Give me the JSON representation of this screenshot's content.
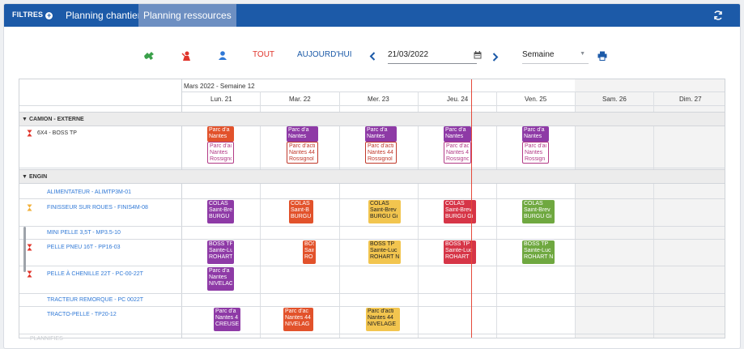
{
  "topbar": {
    "filters_label": "FILTRES",
    "tabs": [
      {
        "label": "Planning chantiers",
        "active": false
      },
      {
        "label": "Planning ressources",
        "active": true
      }
    ]
  },
  "toolbar": {
    "all_label": "TOUT",
    "today_label": "AUJOURD'HUI",
    "date_value": "21/03/2022",
    "period_value": "Semaine"
  },
  "grid": {
    "header_week": "Mars 2022 - Semaine 12",
    "days": [
      "Lun. 21",
      "Mar. 22",
      "Mer. 23",
      "Jeu. 24",
      "Ven. 25",
      "Sam. 26",
      "Dim. 27"
    ],
    "groups": [
      {
        "label": "CAMION - EXTERNE"
      },
      {
        "label": "ENGIN"
      }
    ],
    "resources": [
      {
        "label": "6X4 - BOSS TP",
        "hourglass": "red"
      },
      {
        "label": "ALIMENTATEUR - ALIMTP3M-01",
        "hourglass": ""
      },
      {
        "label": "FINISSEUR SUR ROUES - FINIS4M-08",
        "hourglass": "yellow"
      },
      {
        "label": "MINI PELLE 3,5T - MP3.5-10",
        "hourglass": ""
      },
      {
        "label": "PELLE PNEU 16T - PP16-03",
        "hourglass": "red"
      },
      {
        "label": "PELLE À CHENILLE 22T - PC-00-22T",
        "hourglass": "red"
      },
      {
        "label": "TRACTEUR REMORQUE - PC 0022T",
        "hourglass": ""
      },
      {
        "label": "TRACTO-PELLE - TP20-12",
        "hourglass": ""
      }
    ],
    "next_group_faint": "PLANNIFIES"
  },
  "events": {
    "camion": {
      "mon": {
        "top": [
          "Parc d'a",
          "Nantes"
        ],
        "bottom": [
          "Parc d'acti",
          "Nantes",
          "Rossigno"
        ]
      },
      "tue": {
        "top": [
          "Parc d'a",
          "Nantes"
        ],
        "bottom": [
          "Parc d'acti",
          "Nantes 44",
          "Rossignol"
        ]
      },
      "wed": {
        "top": [
          "Parc d'a",
          "Nantes"
        ],
        "bottom": [
          "Parc d'acti",
          "Nantes 44",
          "Rossignol"
        ]
      },
      "thu": {
        "top": [
          "Parc d'a",
          "Nantes"
        ],
        "bottom": [
          "Parc d'acti",
          "Nantes 4",
          "Rossigno"
        ]
      },
      "fri": {
        "top": [
          "Parc d'a",
          "Nantes"
        ],
        "bottom": [
          "Parc d'acti",
          "Nantes",
          "Rossign"
        ]
      }
    },
    "finisseur": {
      "mon": [
        "COLAS",
        "Saint-Bre",
        "BURGU"
      ],
      "tue": [
        "COLAS",
        "Saint-B",
        "BURGU"
      ],
      "wed": [
        "COLAS",
        "Saint-Brev",
        "BURGU Gi"
      ],
      "thu": [
        "COLAS",
        "Saint-Brev",
        "BURGU Gi"
      ],
      "fri": [
        "COLAS",
        "Saint-Brev",
        "BURGU Gi"
      ]
    },
    "pelle_pneu": {
      "mon": [
        "BOSS TP",
        "Sainte-Lu",
        "ROHART"
      ],
      "tue": [
        "BOS",
        "Sain",
        "RO"
      ],
      "wed": [
        "BOSS TP",
        "Sainte-Luc",
        "ROHART N"
      ],
      "thu": [
        "BOSS TP",
        "Sainte-Luc",
        "ROHART"
      ],
      "fri": [
        "BOSS TP",
        "Sainte-Luc",
        "ROHART N"
      ]
    },
    "pelle_chenille": {
      "mon": [
        "Parc d'a",
        "Nantes",
        "NIVELAG"
      ]
    },
    "tracto": {
      "mon": [
        "Parc d'a",
        "Nantes 4",
        "CREUSE"
      ],
      "tue": [
        "Parc d'ac",
        "Nantes 44",
        "NIVELAG"
      ],
      "wed": [
        "Parc d'acti",
        "Nantes 44",
        "NIVELAGE"
      ]
    }
  },
  "colors": {
    "brand": "#1c5aa8",
    "tab_active": "#6d8fc2",
    "today_line": "#e54a3a",
    "purple": "#8e3aa6",
    "orange": "#e2522b",
    "yellow": "#f2c54f",
    "red": "#d63547",
    "green": "#6fa840",
    "magenta_border": "#b23a86"
  }
}
